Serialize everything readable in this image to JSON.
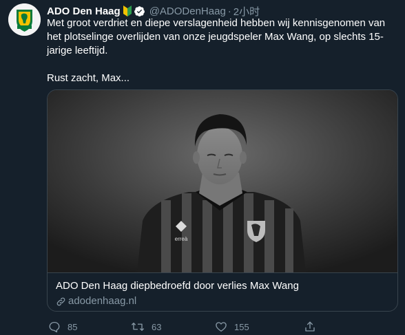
{
  "tweet": {
    "author_name": "ADO Den Haag",
    "handle": "@ADODenHaag",
    "separator": "·",
    "time": "2小时",
    "text_line1": "Met groot verdriet en diepe verslagenheid hebben wij kennisgenomen van het plotselinge overlijden van onze jeugdspeler Max Wang, op slechts 15-jarige leeftijd.",
    "text_line2": "Rust zacht, Max..."
  },
  "card": {
    "title": "ADO Den Haag diepbedroefd door verlies Max Wang",
    "domain": "adodenhaag.nl",
    "image_icon": "black-and-white-player-portrait",
    "kit_text": "erreà"
  },
  "actions": {
    "reply_count": "85",
    "retweet_count": "63",
    "like_count": "155"
  },
  "colors": {
    "background": "#15202b",
    "secondary_text": "#8899a6",
    "border": "#38444d",
    "club_green": "#0a7a3a",
    "club_yellow": "#f2c200"
  }
}
